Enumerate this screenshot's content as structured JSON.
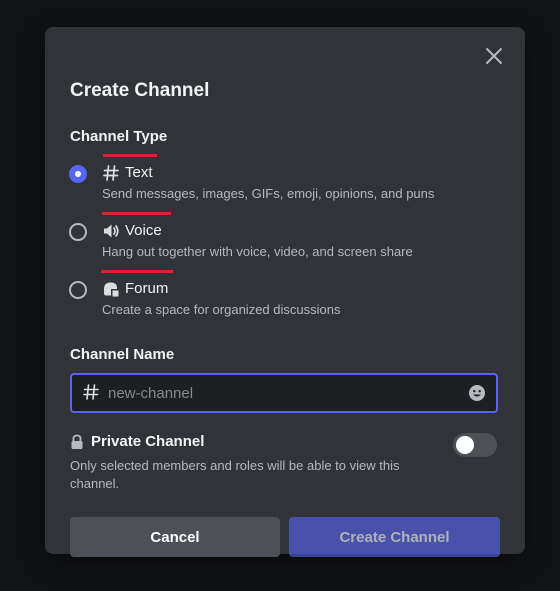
{
  "modal": {
    "title": "Create Channel",
    "close_icon": "close-icon"
  },
  "channel_type": {
    "label": "Channel Type",
    "selected": "text",
    "options": [
      {
        "id": "text",
        "name": "Text",
        "icon": "hash-icon",
        "description": "Send messages, images, GIFs, emoji, opinions, and puns"
      },
      {
        "id": "voice",
        "name": "Voice",
        "icon": "speaker-icon",
        "description": "Hang out together with voice, video, and screen share"
      },
      {
        "id": "forum",
        "name": "Forum",
        "icon": "forum-icon",
        "description": "Create a space for organized discussions"
      }
    ]
  },
  "channel_name": {
    "label": "Channel Name",
    "value": "",
    "placeholder": "new-channel",
    "prefix_icon": "hash-icon",
    "suffix_icon": "emoji-icon"
  },
  "private_channel": {
    "label": "Private Channel",
    "icon": "lock-icon",
    "description": "Only selected members and roles will be able to view this channel.",
    "enabled": false
  },
  "footer": {
    "cancel_label": "Cancel",
    "create_label": "Create Channel"
  },
  "colors": {
    "background": "#111214",
    "modal": "#313338",
    "accent": "#5865f2",
    "annotation": "#d7202b"
  }
}
